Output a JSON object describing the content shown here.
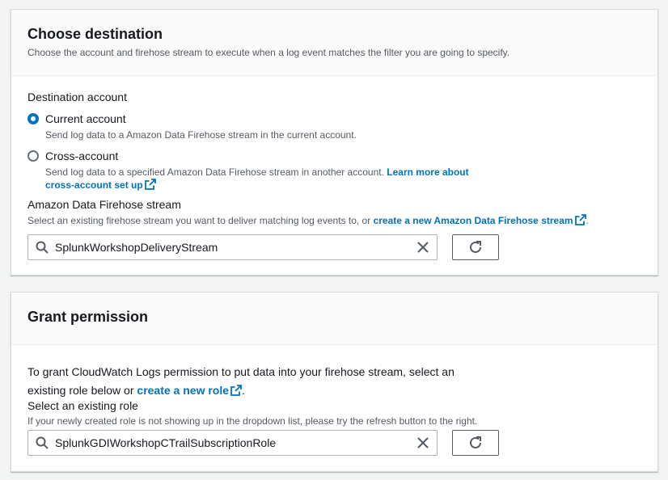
{
  "destination": {
    "title": "Choose destination",
    "description": "Choose the account and firehose stream to execute when a log event matches the filter you are going to specify.",
    "account_label": "Destination account",
    "options": [
      {
        "label": "Current account",
        "description": "Send log data to a Amazon Data Firehose stream in the current account.",
        "selected": true
      },
      {
        "label": "Cross-account",
        "description": "Send log data to a specified Amazon Data Firehose stream in another account.",
        "link_line1": "Learn more about",
        "link_line2": "cross-account set up",
        "selected": false
      }
    ],
    "stream_label": "Amazon Data Firehose stream",
    "stream_desc": "Select an existing firehose stream you want to deliver matching log events to, or",
    "stream_link": "create a new Amazon Data Firehose stream",
    "stream_value": "SplunkWorkshopDeliveryStream"
  },
  "permission": {
    "title": "Grant permission",
    "text_line1": "To grant CloudWatch Logs permission to put data into your firehose stream, select an",
    "text_line2": "existing role below or",
    "role_link": "create a new role",
    "role_label": "Select an existing role",
    "role_desc": "If your newly created role is not showing up in the dropdown list, please try the refresh button to the right.",
    "role_value": "SplunkGDIWorkshopCTrailSubscriptionRole"
  },
  "colors": {
    "link": "#0073bb",
    "radio_selected": "#0073bb",
    "text": "#16191f",
    "secondary_text": "#545b64"
  },
  "icons": {
    "search": "search-icon",
    "clear": "close-icon",
    "refresh": "refresh-icon",
    "external": "external-link-icon"
  }
}
